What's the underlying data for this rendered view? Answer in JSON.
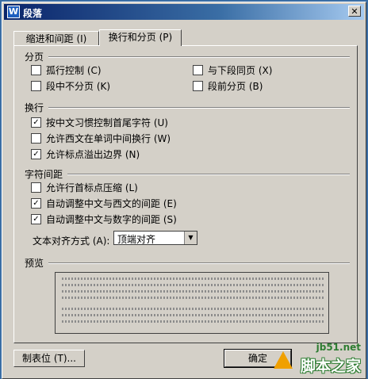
{
  "window": {
    "title": "段落",
    "app_icon": "W",
    "close_glyph": "✕"
  },
  "tabs": [
    {
      "label": "缩进和间距 (I)",
      "active": false
    },
    {
      "label": "换行和分页 (P)",
      "active": true
    }
  ],
  "groups": {
    "pagination": {
      "title": "分页",
      "options": [
        {
          "label": "孤行控制 (C)",
          "checked": false
        },
        {
          "label": "段中不分页 (K)",
          "checked": false
        },
        {
          "label": "与下段同页 (X)",
          "checked": false
        },
        {
          "label": "段前分页 (B)",
          "checked": false
        }
      ]
    },
    "line_break": {
      "title": "换行",
      "options": [
        {
          "label": "按中文习惯控制首尾字符 (U)",
          "checked": true
        },
        {
          "label": "允许西文在单词中间换行 (W)",
          "checked": false
        },
        {
          "label": "允许标点溢出边界 (N)",
          "checked": true
        }
      ]
    },
    "char_spacing": {
      "title": "字符间距",
      "options": [
        {
          "label": "允许行首标点压缩 (L)",
          "checked": false
        },
        {
          "label": "自动调整中文与西文的间距 (E)",
          "checked": true
        },
        {
          "label": "自动调整中文与数字的间距 (S)",
          "checked": true
        }
      ],
      "text_align_label": "文本对齐方式 (A):",
      "text_align_value": "顶端对齐"
    },
    "preview": {
      "title": "预览"
    }
  },
  "buttons": {
    "tabs_label": "制表位 (T)...",
    "ok_label": "确定"
  },
  "watermark": {
    "url": "jb51.net",
    "name": "脚本之家"
  },
  "icons": {
    "check": "✓",
    "dropdown": "▼"
  }
}
